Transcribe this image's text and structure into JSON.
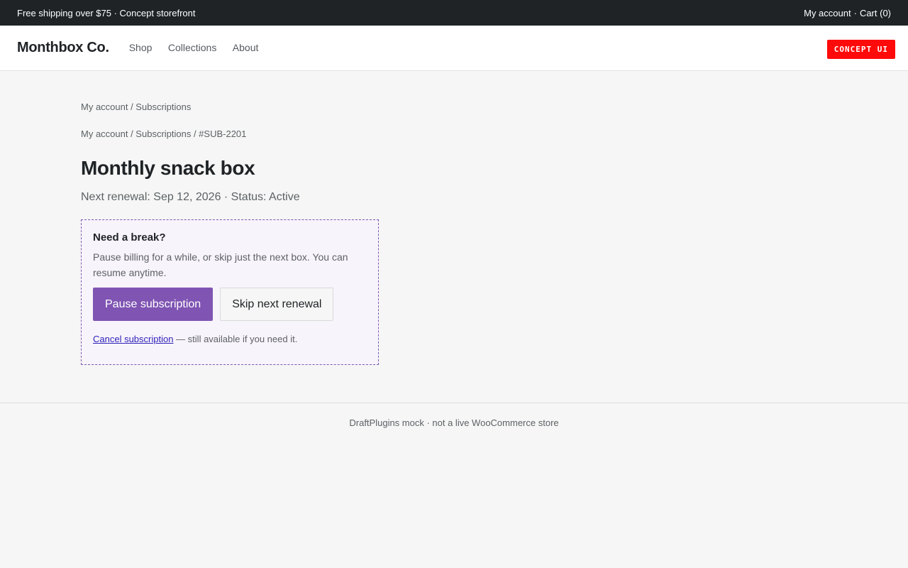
{
  "topbar": {
    "promo": "Free shipping over $75 · Concept storefront",
    "account_link": "My account",
    "separator": "·",
    "cart_link": "Cart (0)"
  },
  "header": {
    "brand": "Monthbox Co.",
    "nav": [
      "Shop",
      "Collections",
      "About"
    ],
    "badge": "CONCEPT UI"
  },
  "breadcrumbs": {
    "primary": "My account / Subscriptions",
    "secondary": "My account / Subscriptions / #SUB-2201"
  },
  "subscription": {
    "title": "Monthly snack box",
    "meta": "Next renewal: Sep 12, 2026 · Status: Active"
  },
  "break_card": {
    "heading": "Need a break?",
    "description": "Pause billing for a while, or skip just the next box. You can resume anytime.",
    "pause_label": "Pause subscription",
    "skip_label": "Skip next renewal",
    "cancel_link": "Cancel subscription",
    "cancel_note": " — still available if you need it."
  },
  "footer": {
    "text": "DraftPlugins mock · not a live WooCommerce store"
  },
  "colors": {
    "topbar_bg": "#1f2326",
    "accent": "#7f54b3",
    "badge": "#ff0a0a",
    "link": "#2b1fb8"
  }
}
